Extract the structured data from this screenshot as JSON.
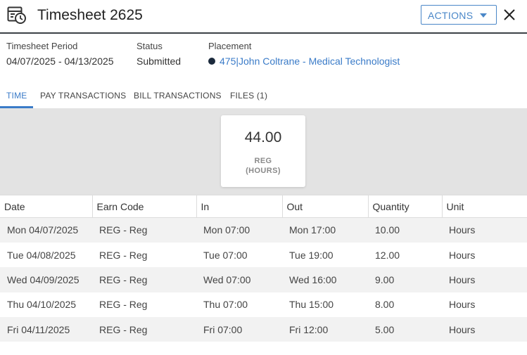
{
  "header": {
    "title": "Timesheet 2625",
    "actions_label": "ACTIONS"
  },
  "info": {
    "period_label": "Timesheet Period",
    "period_value": "04/07/2025 - 04/13/2025",
    "status_label": "Status",
    "status_value": "Submitted",
    "placement_label": "Placement",
    "placement_value": "475|John Coltrane - Medical Technologist"
  },
  "tabs": [
    {
      "label": "TIME",
      "active": true
    },
    {
      "label": "PAY TRANSACTIONS",
      "active": false
    },
    {
      "label": "BILL TRANSACTIONS",
      "active": false
    },
    {
      "label": "FILES (1)",
      "active": false
    }
  ],
  "summary": {
    "value": "44.00",
    "code": "REG",
    "unit": "(HOURS)"
  },
  "table": {
    "columns": [
      "Date",
      "Earn Code",
      "In",
      "Out",
      "Quantity",
      "Unit"
    ],
    "rows": [
      [
        "Mon 04/07/2025",
        "REG - Reg",
        "Mon 07:00",
        "Mon 17:00",
        "10.00",
        "Hours"
      ],
      [
        "Tue 04/08/2025",
        "REG - Reg",
        "Tue 07:00",
        "Tue 19:00",
        "12.00",
        "Hours"
      ],
      [
        "Wed 04/09/2025",
        "REG - Reg",
        "Wed 07:00",
        "Wed 16:00",
        "9.00",
        "Hours"
      ],
      [
        "Thu 04/10/2025",
        "REG - Reg",
        "Thu 07:00",
        "Thu 15:00",
        "8.00",
        "Hours"
      ],
      [
        "Fri 04/11/2025",
        "REG - Reg",
        "Fri 07:00",
        "Fri 12:00",
        "5.00",
        "Hours"
      ]
    ]
  },
  "colors": {
    "accent": "#3a7bc8",
    "header_rule": "#3c4146",
    "band": "#e3e3e3",
    "stripe": "#f2f2f2"
  },
  "icons": {
    "title_icon": "timesheet-clock-icon",
    "actions_icon": "caret-down-icon",
    "close_icon": "close-icon",
    "placement_icon": "status-dot-icon"
  }
}
